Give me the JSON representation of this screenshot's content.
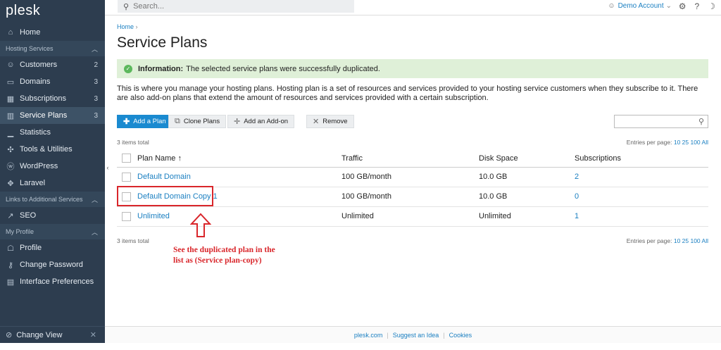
{
  "sidebar": {
    "logo": "plesk",
    "items": [
      {
        "type": "item",
        "label": "Home",
        "icon": "⌂",
        "count": ""
      },
      {
        "type": "section",
        "label": "Hosting Services"
      },
      {
        "type": "item",
        "label": "Customers",
        "icon": "☺",
        "count": "2"
      },
      {
        "type": "item",
        "label": "Domains",
        "icon": "▭",
        "count": "3"
      },
      {
        "type": "item",
        "label": "Subscriptions",
        "icon": "▦",
        "count": "3"
      },
      {
        "type": "item",
        "label": "Service Plans",
        "icon": "▥",
        "count": "3",
        "active": true
      },
      {
        "type": "item",
        "label": "Statistics",
        "icon": "▁",
        "count": ""
      },
      {
        "type": "item",
        "label": "Tools & Utilities",
        "icon": "✣",
        "count": ""
      },
      {
        "type": "item",
        "label": "WordPress",
        "icon": "ⓦ",
        "count": ""
      },
      {
        "type": "item",
        "label": "Laravel",
        "icon": "✥",
        "count": ""
      },
      {
        "type": "section",
        "label": "Links to Additional Services"
      },
      {
        "type": "item",
        "label": "SEO",
        "icon": "↗",
        "count": ""
      },
      {
        "type": "section",
        "label": "My Profile"
      },
      {
        "type": "item",
        "label": "Profile",
        "icon": "☖",
        "count": ""
      },
      {
        "type": "item",
        "label": "Change Password",
        "icon": "⚷",
        "count": ""
      },
      {
        "type": "item",
        "label": "Interface Preferences",
        "icon": "▤",
        "count": ""
      }
    ],
    "change_view": "Change View"
  },
  "topbar": {
    "search_placeholder": "Search...",
    "account": "Demo Account"
  },
  "main": {
    "breadcrumb": "Home",
    "title": "Service Plans",
    "info_bold": "Information:",
    "info_text": "The selected service plans were successfully duplicated.",
    "description": "This is where you manage your hosting plans. Hosting plan is a set of resources and services provided to your hosting service customers when they subscribe to it. There are also add-on plans that extend the amount of resources and services provided with a certain subscription.",
    "toolbar": {
      "add_plan": "Add a Plan",
      "clone_plans": "Clone Plans",
      "add_addon": "Add an Add-on",
      "remove": "Remove"
    },
    "items_total": "3 items total",
    "entries_label": "Entries per page:",
    "entries_options": "10 25 100 All",
    "columns": [
      "Plan Name ↑",
      "Traffic",
      "Disk Space",
      "Subscriptions"
    ],
    "rows": [
      {
        "name": "Default Domain",
        "traffic": "100 GB/month",
        "disk": "10.0 GB",
        "subs": "2"
      },
      {
        "name": "Default Domain Copy 1",
        "traffic": "100 GB/month",
        "disk": "10.0 GB",
        "subs": "0"
      },
      {
        "name": "Unlimited",
        "traffic": "Unlimited",
        "disk": "Unlimited",
        "subs": "1"
      }
    ]
  },
  "annotation": {
    "line1": "See the duplicated plan in the",
    "line2": "list as (Service plan-copy)",
    "color": "#d9262b"
  },
  "footer": {
    "links": [
      "plesk.com",
      "Suggest an Idea",
      "Cookies"
    ]
  }
}
